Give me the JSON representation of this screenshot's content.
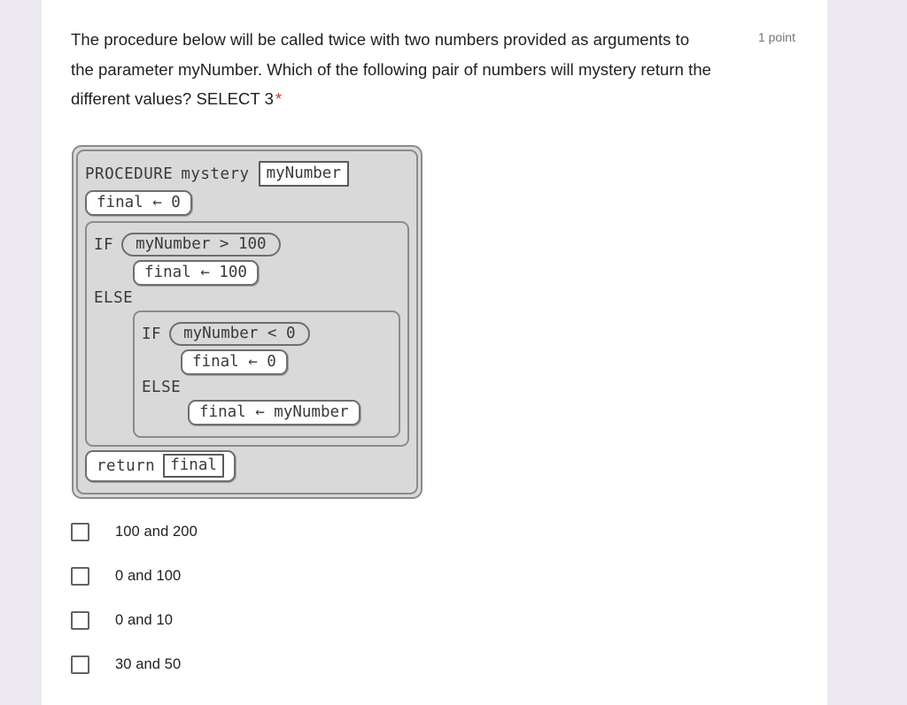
{
  "question": {
    "text": "The procedure below will be called twice with two numbers provided as arguments to the parameter myNumber. Which of the following pair of numbers will mystery return the different values? SELECT 3",
    "required_marker": "*",
    "points_label": "1 point"
  },
  "pseudocode": {
    "header": {
      "keyword": "PROCEDURE",
      "name": "mystery",
      "parameter": "myNumber"
    },
    "init_statement": "final ← 0",
    "outer_if": {
      "keyword": "IF",
      "condition": "myNumber > 100",
      "then_statement": "final ← 100",
      "else_keyword": "ELSE"
    },
    "inner_if": {
      "keyword": "IF",
      "condition": "myNumber < 0",
      "then_statement": "final ← 0",
      "else_keyword": "ELSE",
      "else_statement": "final ← myNumber"
    },
    "return_statement": {
      "keyword": "return",
      "value": "final"
    }
  },
  "options": [
    {
      "label": "100 and 200",
      "checked": false
    },
    {
      "label": "0 and 100",
      "checked": false
    },
    {
      "label": "0 and 10",
      "checked": false
    },
    {
      "label": "30 and 50",
      "checked": false
    }
  ],
  "colors": {
    "page_background": "#ece9f1",
    "card_background": "#ffffff",
    "required_red": "#d93025",
    "code_block_gray": "#d9d9d9",
    "text_primary": "#202124",
    "text_secondary": "#70757a"
  }
}
